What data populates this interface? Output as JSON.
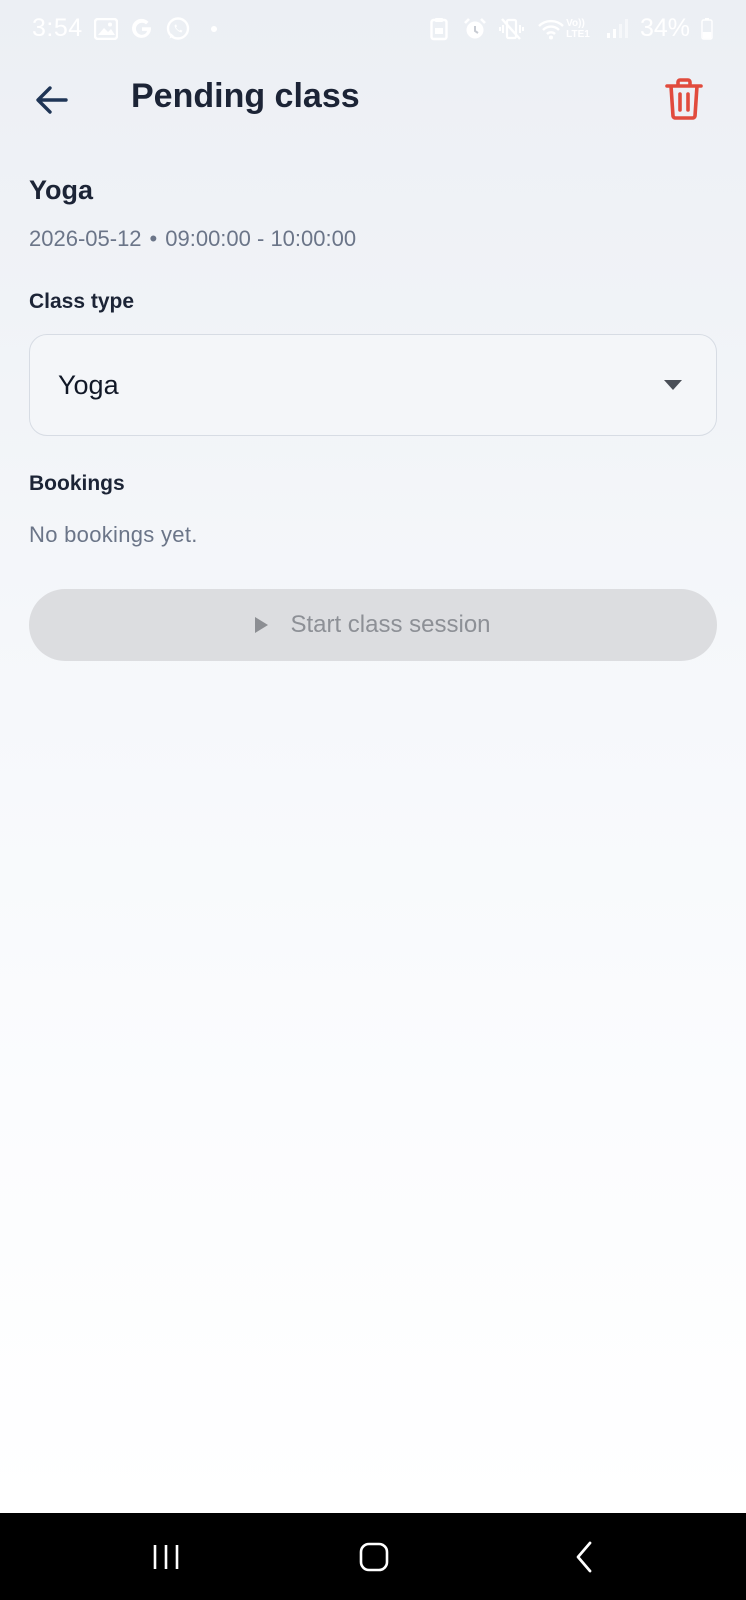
{
  "status_bar": {
    "time": "3:54",
    "left_icons": [
      "gallery-icon",
      "google-icon",
      "whatsapp-icon",
      "dot-icon"
    ],
    "right_icons": [
      "clipboard-icon",
      "alarm-icon",
      "vibrate-icon",
      "wifi-icon",
      "volte-signal-icon"
    ],
    "volte_label": "Vo))",
    "lte_label": "LTE1",
    "battery": "34%"
  },
  "app_bar": {
    "title": "Pending class"
  },
  "class": {
    "name": "Yoga",
    "date": "2026-05-12",
    "separator": "•",
    "time_range": "09:00:00 - 10:00:00"
  },
  "class_type": {
    "label": "Class type",
    "selected": "Yoga"
  },
  "bookings": {
    "label": "Bookings",
    "empty_text": "No bookings yet."
  },
  "start_button": {
    "label": "Start class session"
  },
  "colors": {
    "delete": "#e14b3d",
    "back_arrow": "#1f3556",
    "title": "#1c2436",
    "muted": "#6b7588",
    "disabled_bg": "#dcdde0",
    "disabled_text": "#8d9096"
  }
}
